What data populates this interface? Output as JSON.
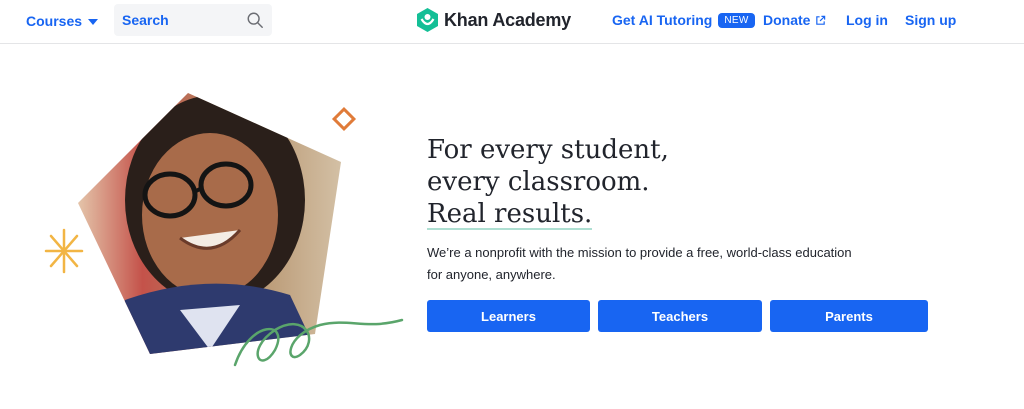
{
  "header": {
    "courses_label": "Courses",
    "search_label": "Search",
    "logo_text": "Khan Academy",
    "ai_label": "Get AI Tutoring",
    "ai_badge": "NEW",
    "donate_label": "Donate",
    "login_label": "Log in",
    "signup_label": "Sign up"
  },
  "hero": {
    "headline_line1": "For every student,",
    "headline_line2": "every classroom.",
    "headline_line3": "Real results.",
    "subtext": "We’re a nonprofit with the mission to provide a free, world-class education for anyone, anywhere.",
    "buttons": [
      "Learners",
      "Teachers",
      "Parents"
    ]
  },
  "colors": {
    "brand_blue": "#1865f2",
    "logo_green": "#14bf96",
    "doodle_orange": "#e07b39",
    "doodle_yellow": "#f2b544",
    "doodle_green": "#5aa56b"
  },
  "icons": [
    "chevron-down-icon",
    "search-icon",
    "khan-logo-icon",
    "external-link-icon"
  ]
}
